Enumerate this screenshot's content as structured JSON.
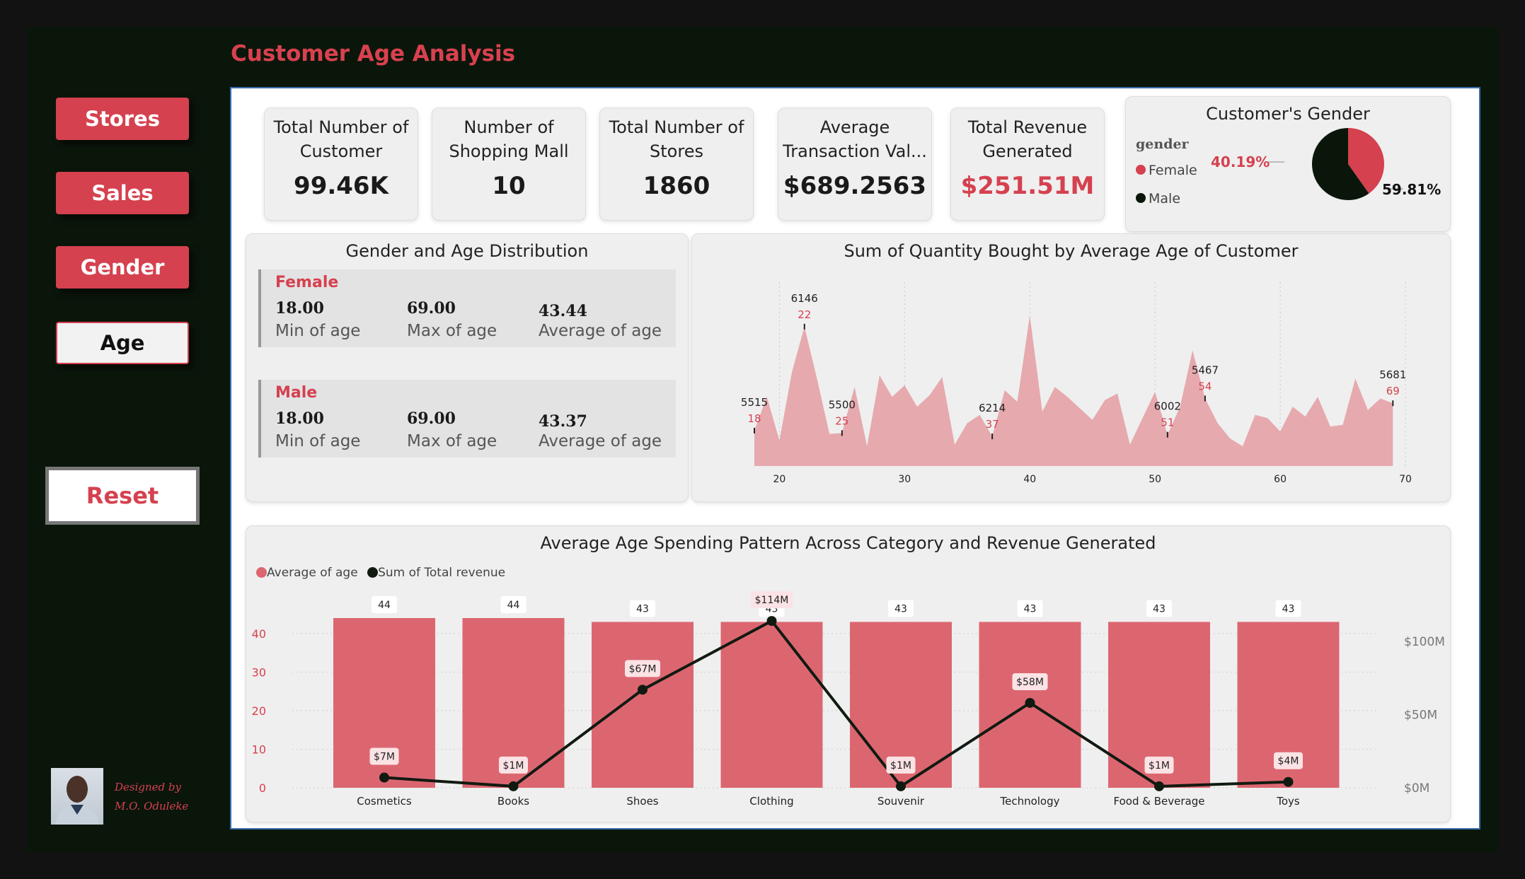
{
  "page": {
    "title": "Customer Age Analysis"
  },
  "nav": [
    {
      "label": "Stores",
      "active": false
    },
    {
      "label": "Sales",
      "active": false
    },
    {
      "label": "Gender",
      "active": false
    },
    {
      "label": "Age",
      "active": true
    }
  ],
  "reset_label": "Reset",
  "designer": {
    "line1": "Designed by",
    "line2": "M.O. Oduleke"
  },
  "kpis": [
    {
      "label_line1": "Total Number of",
      "label_line2": "Customer",
      "value": "99.46K"
    },
    {
      "label_line1": "Number of",
      "label_line2": "Shopping Mall",
      "value": "10"
    },
    {
      "label_line1": "Total Number of",
      "label_line2": "Stores",
      "value": "1860"
    },
    {
      "label_line1": "Average",
      "label_line2": "Transaction Val...",
      "value": "$689.2563"
    },
    {
      "label_line1": "Total Revenue",
      "label_line2": "Generated",
      "value": "$251.51M"
    }
  ],
  "gender_pie": {
    "title": "Customer's Gender",
    "legend_title": "gender",
    "slices": [
      {
        "label": "Female",
        "percent_text": "40.19%",
        "percent": 40.19,
        "color": "#d5414f"
      },
      {
        "label": "Male",
        "percent_text": "59.81%",
        "percent": 59.81,
        "color": "#0b160b"
      }
    ]
  },
  "gender_age": {
    "title": "Gender and Age Distribution",
    "groups": [
      {
        "gender": "Female",
        "min": "18.00",
        "max": "69.00",
        "avg": "43.44",
        "min_label": "Min of age",
        "max_label": "Max of age",
        "avg_label": "Average of age"
      },
      {
        "gender": "Male",
        "min": "18.00",
        "max": "69.00",
        "avg": "43.37",
        "min_label": "Min of age",
        "max_label": "Max of age",
        "avg_label": "Average of age"
      }
    ]
  },
  "chart_data": [
    {
      "type": "area",
      "title": "Sum of Quantity Bought by Average Age of Customer",
      "xlim": [
        18,
        70
      ],
      "x_ticks": [
        "20",
        "30",
        "40",
        "50",
        "60",
        "70"
      ],
      "color": "#e6a9ae",
      "x": [
        18,
        19,
        20,
        21,
        22,
        23,
        24,
        25,
        26,
        27,
        28,
        29,
        30,
        31,
        32,
        33,
        34,
        35,
        36,
        37,
        38,
        39,
        40,
        41,
        42,
        43,
        44,
        45,
        46,
        47,
        48,
        49,
        50,
        51,
        52,
        53,
        54,
        55,
        56,
        57,
        58,
        59,
        60,
        61,
        62,
        63,
        64,
        65,
        66,
        67,
        68,
        69
      ],
      "values": [
        5515,
        5720,
        5455,
        5870,
        6146,
        5830,
        5495,
        5500,
        5780,
        5420,
        5850,
        5720,
        5790,
        5660,
        5730,
        5840,
        5430,
        5560,
        5610,
        5480,
        5760,
        5690,
        6214,
        5630,
        5780,
        5720,
        5650,
        5580,
        5700,
        5740,
        5430,
        5590,
        5750,
        5490,
        5660,
        6002,
        5710,
        5560,
        5467,
        5420,
        5610,
        5590,
        5510,
        5660,
        5600,
        5720,
        5540,
        5550,
        5830,
        5640,
        5710,
        5681
      ],
      "point_labels": [
        {
          "x": 18,
          "value": "5515",
          "age": "18"
        },
        {
          "x": 22,
          "value": "6146",
          "age": "22"
        },
        {
          "x": 25,
          "value": "5500",
          "age": "25"
        },
        {
          "x": 37,
          "value": "6214",
          "age": "37"
        },
        {
          "x": 51,
          "value": "6002",
          "age": "51"
        },
        {
          "x": 54,
          "value": "5467",
          "age": "54"
        },
        {
          "x": 69,
          "value": "5681",
          "age": "69"
        }
      ]
    },
    {
      "type": "bar",
      "title": "Average Age Spending Pattern Across Category and Revenue Generated",
      "legend": [
        "Average of age",
        "Sum of Total revenue"
      ],
      "categories": [
        "Cosmetics",
        "Books",
        "Shoes",
        "Clothing",
        "Souvenir",
        "Technology",
        "Food & Beverage",
        "Toys"
      ],
      "series": [
        {
          "name": "Average of age",
          "kind": "bar",
          "values": [
            44,
            44,
            43,
            43,
            43,
            43,
            43,
            43
          ],
          "labels": [
            "44",
            "44",
            "43",
            "43",
            "43",
            "43",
            "43",
            "43"
          ],
          "color": "#dc6670"
        },
        {
          "name": "Sum of Total revenue",
          "kind": "line",
          "values": [
            7,
            1,
            67,
            114,
            1,
            58,
            1,
            4
          ],
          "labels": [
            "$7M",
            "$1M",
            "$67M",
            "$114M",
            "$1M",
            "$58M",
            "$1M",
            "$4M"
          ],
          "color": "#111a11"
        }
      ],
      "ylim": [
        0,
        44
      ],
      "y_ticks": [
        "0",
        "10",
        "20",
        "30",
        "40"
      ],
      "y2lim": [
        0,
        115
      ],
      "y2_ticks": [
        "$0M",
        "$50M",
        "$100M"
      ]
    }
  ]
}
